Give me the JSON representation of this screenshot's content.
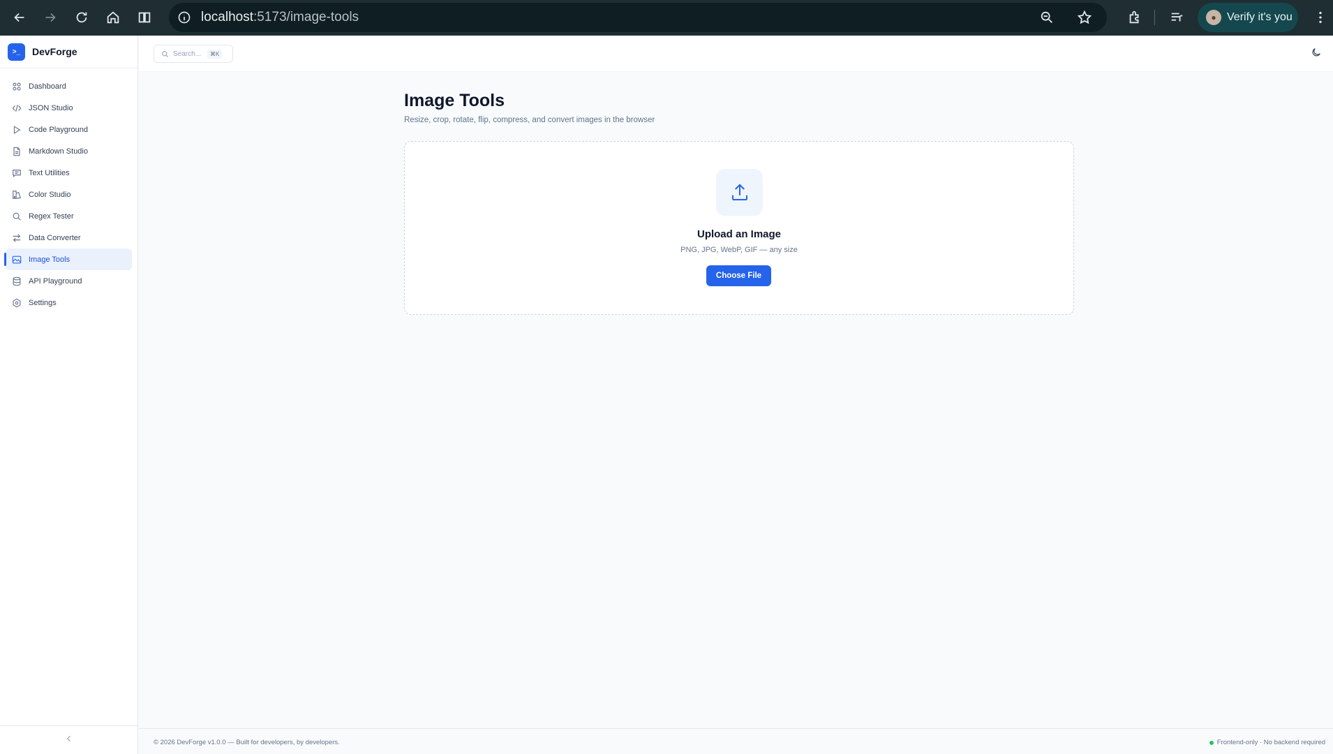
{
  "browser": {
    "url_host": "localhost",
    "url_path": ":5173/image-tools",
    "profile_label": "Verify it's you",
    "icons": [
      "back-icon",
      "forward-icon",
      "reload-icon",
      "home-icon",
      "split-view-icon",
      "site-info-icon",
      "zoom-icon",
      "bookmark-star-icon",
      "extensions-icon",
      "media-icon",
      "menu-icon"
    ]
  },
  "brand": {
    "name": "DevForge"
  },
  "sidebar": {
    "items": [
      {
        "label": "Dashboard",
        "icon": "grid-icon"
      },
      {
        "label": "JSON Studio",
        "icon": "code-icon"
      },
      {
        "label": "Code Playground",
        "icon": "play-icon"
      },
      {
        "label": "Markdown Studio",
        "icon": "file-icon"
      },
      {
        "label": "Text Utilities",
        "icon": "message-icon"
      },
      {
        "label": "Color Studio",
        "icon": "swatch-icon"
      },
      {
        "label": "Regex Tester",
        "icon": "search-icon"
      },
      {
        "label": "Data Converter",
        "icon": "arrows-icon"
      },
      {
        "label": "Image Tools",
        "icon": "image-icon",
        "active": true
      },
      {
        "label": "API Playground",
        "icon": "database-icon"
      },
      {
        "label": "Settings",
        "icon": "gear-icon"
      }
    ]
  },
  "topbar": {
    "search_placeholder": "Search...",
    "search_shortcut": "⌘K"
  },
  "page": {
    "title": "Image Tools",
    "subtitle": "Resize, crop, rotate, flip, compress, and convert images in the browser"
  },
  "upload": {
    "title": "Upload an Image",
    "formats": "PNG, JPG, WebP, GIF — any size",
    "button_label": "Choose File"
  },
  "footer": {
    "left": "© 2026 DevForge v1.0.0 — Built for developers, by developers.",
    "right": "Frontend-only · No backend required"
  },
  "colors": {
    "accent": "#2563eb",
    "status_ok": "#22c55e",
    "chrome_bg": "#1f2e33"
  }
}
